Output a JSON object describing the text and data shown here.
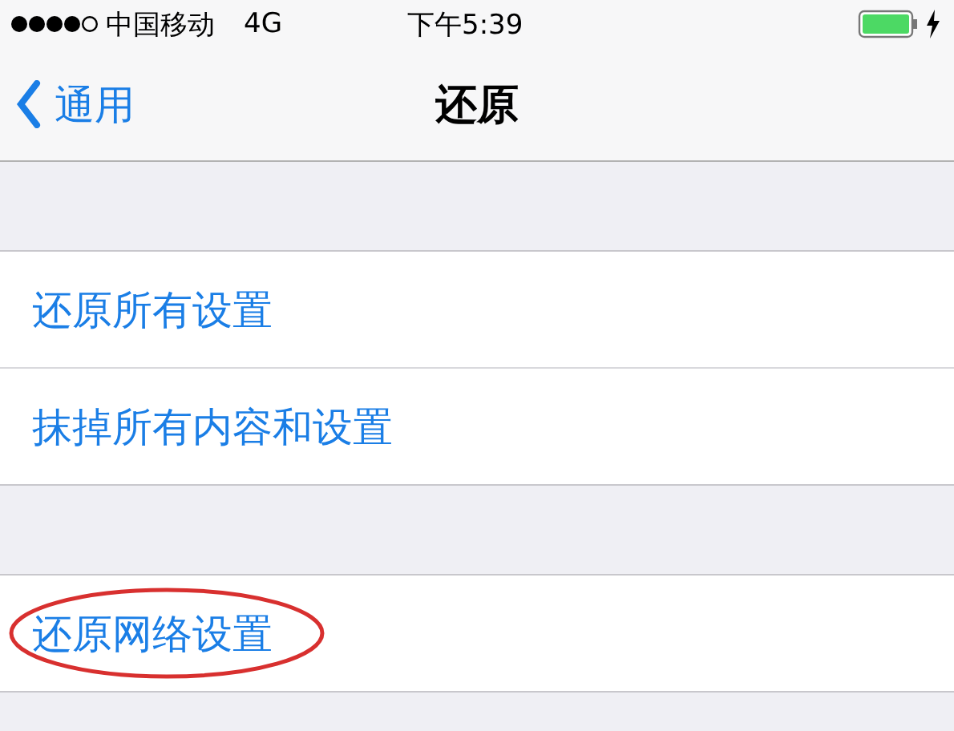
{
  "status_bar": {
    "carrier": "中国移动",
    "network": "4G",
    "time": "下午5:39"
  },
  "nav_bar": {
    "back": "通用",
    "title": "还原"
  },
  "groups": [
    {
      "items": [
        {
          "label": "还原所有设置",
          "circled": false
        },
        {
          "label": "抹掉所有内容和设置",
          "circled": false
        }
      ]
    },
    {
      "items": [
        {
          "label": "还原网络设置",
          "circled": true
        }
      ]
    }
  ]
}
